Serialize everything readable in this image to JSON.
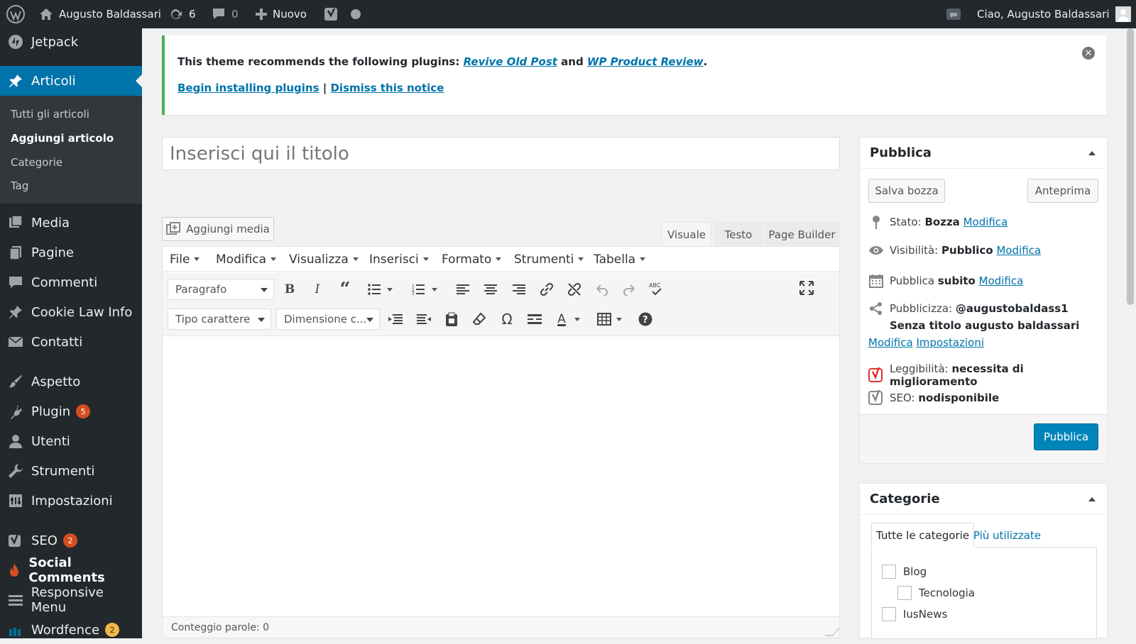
{
  "adminbar": {
    "site_name": "Augusto Baldassari",
    "updates_count": "6",
    "comments_count": "0",
    "new_label": "Nuovo",
    "greeting": "Ciao, Augusto Baldassari"
  },
  "sidebar": {
    "items": [
      {
        "label": "Jetpack",
        "icon": "jetpack-icon"
      },
      {
        "label": "Articoli",
        "icon": "pin-icon"
      },
      {
        "label": "Media",
        "icon": "media-icon"
      },
      {
        "label": "Pagine",
        "icon": "pages-icon"
      },
      {
        "label": "Commenti",
        "icon": "comments-icon"
      },
      {
        "label": "Cookie Law Info",
        "icon": "pin-icon"
      },
      {
        "label": "Contatti",
        "icon": "mail-icon"
      },
      {
        "label": "Aspetto",
        "icon": "brush-icon"
      },
      {
        "label": "Plugin",
        "icon": "plugin-icon",
        "badge": "5"
      },
      {
        "label": "Utenti",
        "icon": "users-icon"
      },
      {
        "label": "Strumenti",
        "icon": "wrench-icon"
      },
      {
        "label": "Impostazioni",
        "icon": "settings-icon"
      },
      {
        "label": "SEO",
        "icon": "yoast-icon",
        "badge": "2"
      },
      {
        "label": "Social Comments",
        "icon": "flame-icon"
      },
      {
        "label": "Responsive Menu",
        "icon": "menu-icon"
      },
      {
        "label": "Wordfence",
        "icon": "wordfence-icon",
        "badge": "2"
      }
    ],
    "submenu": [
      "Tutti gli articoli",
      "Aggiungi articolo",
      "Categorie",
      "Tag"
    ]
  },
  "notice": {
    "text_before": "This theme recommends the following plugins: ",
    "plugin1": "Revive Old Post",
    "and": " and ",
    "plugin2": "WP Product Review",
    "period": ".",
    "install_link": "Begin installing plugins",
    "separator": " | ",
    "dismiss_link": "Dismiss this notice"
  },
  "editor": {
    "title_placeholder": "Inserisci qui il titolo",
    "add_media": "Aggiungi media",
    "tabs": [
      "Visuale",
      "Testo",
      "Page Builder"
    ],
    "menus": [
      "File",
      "Modifica",
      "Visualizza",
      "Inserisci",
      "Formato",
      "Strumenti",
      "Tabella"
    ],
    "paragraph_select": "Paragrafo",
    "font_select": "Tipo carattere",
    "size_select": "Dimensione c...",
    "word_count": "Conteggio parole: 0"
  },
  "publish": {
    "title": "Pubblica",
    "save_draft": "Salva bozza",
    "preview": "Anteprima",
    "status_label": "Stato: ",
    "status_value": "Bozza",
    "visibility_label": "Visibilità: ",
    "visibility_value": "Pubblico",
    "publish_label": "Pubblica ",
    "publish_value": "subito",
    "edit_link": "Modifica",
    "publicize_label": "Pubblicizza: ",
    "publicize_value": "@augustobaldass1 Senza titolo augusto baldassari",
    "settings_link": "Impostazioni",
    "readability_label": "Leggibilità: ",
    "readability_value": "necessita di miglioramento",
    "seo_label": "SEO: ",
    "seo_value": "nodisponibile",
    "publish_button": "Pubblica"
  },
  "categories": {
    "title": "Categorie",
    "tab_all": "Tutte le categorie",
    "tab_popular": "Più utilizzate",
    "items": [
      "Blog",
      "Tecnologia",
      "IusNews"
    ]
  },
  "colors": {
    "accent": "#0073aa",
    "sidebar": "#23282d",
    "notice_border": "#46b450",
    "badge": "#d54e21"
  }
}
